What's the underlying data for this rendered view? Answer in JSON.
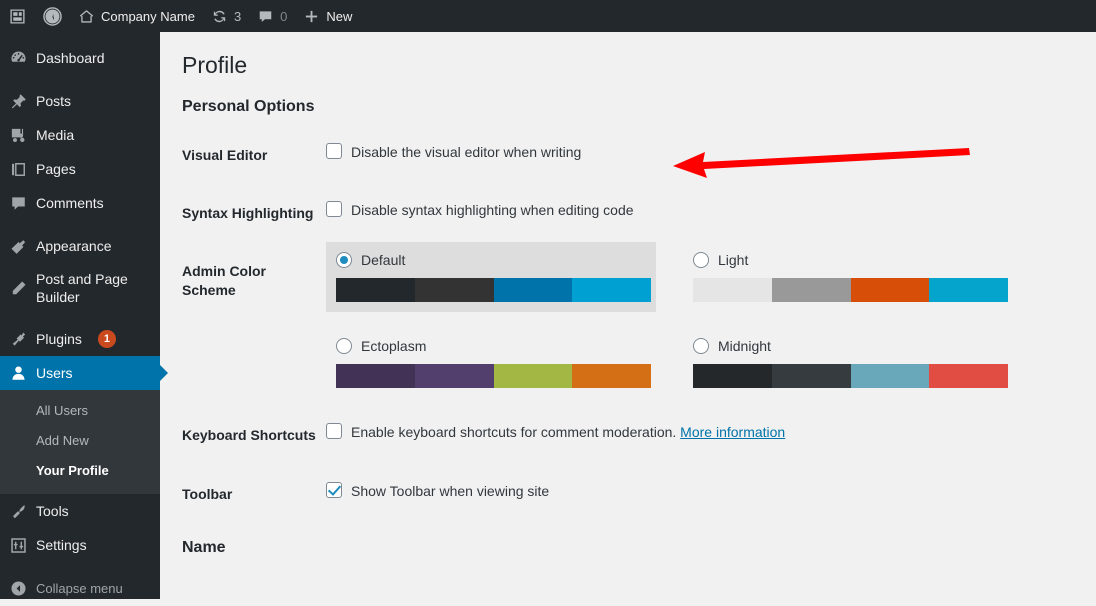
{
  "adminbar": {
    "items": [
      {
        "icon": "wp-logo-placeholder-icon",
        "label": ""
      },
      {
        "icon": "wordpress-logo-icon",
        "label": ""
      },
      {
        "icon": "home-icon",
        "label": "Company Name"
      },
      {
        "icon": "updates-icon",
        "label": "3"
      },
      {
        "icon": "comment-bubble-icon",
        "label": "0"
      },
      {
        "icon": "plus-icon",
        "label": "New"
      }
    ],
    "site_name": "Company Name",
    "updates_count": "3",
    "comments_count": "0",
    "new_label": "New"
  },
  "sidebar": {
    "items": [
      {
        "label": "Dashboard",
        "icon": "dashboard-icon",
        "badge": ""
      },
      {
        "label": "Posts",
        "icon": "pin-icon",
        "badge": ""
      },
      {
        "label": "Media",
        "icon": "media-icon",
        "badge": ""
      },
      {
        "label": "Pages",
        "icon": "pages-icon",
        "badge": ""
      },
      {
        "label": "Comments",
        "icon": "comment-bubble-icon",
        "badge": ""
      },
      {
        "label": "Appearance",
        "icon": "paintbrush-icon",
        "badge": ""
      },
      {
        "label": "Post and Page Builder",
        "icon": "pencil-icon",
        "badge": ""
      },
      {
        "label": "Plugins",
        "icon": "plug-icon",
        "badge": "1"
      },
      {
        "label": "Users",
        "icon": "user-icon",
        "badge": ""
      },
      {
        "label": "Tools",
        "icon": "wrench-icon",
        "badge": ""
      },
      {
        "label": "Settings",
        "icon": "settings-sliders-icon",
        "badge": ""
      }
    ],
    "users_submenu": [
      {
        "label": "All Users",
        "current": false
      },
      {
        "label": "Add New",
        "current": false
      },
      {
        "label": "Your Profile",
        "current": true
      }
    ],
    "collapse_label": "Collapse menu",
    "collapse_icon": "collapse-arrow-icon",
    "active_item": "Users",
    "accent_color": "#0073aa",
    "background_color": "#23282d"
  },
  "main": {
    "page_title": "Profile",
    "personal_options_title": "Personal Options",
    "name_section_title": "Name",
    "rows": {
      "visual_editor": {
        "label": "Visual Editor",
        "checkbox_label": "Disable the visual editor when writing",
        "checked": false
      },
      "syntax_highlighting": {
        "label": "Syntax Highlighting",
        "checkbox_label": "Disable syntax highlighting when editing code",
        "checked": false
      },
      "admin_color_scheme": {
        "label": "Admin Color Scheme",
        "schemes": [
          {
            "name": "Default",
            "selected": true,
            "colors": [
              "#23282d",
              "#333333",
              "#0073aa",
              "#00a0d2"
            ]
          },
          {
            "name": "Light",
            "selected": false,
            "colors": [
              "#e5e5e5",
              "#999999",
              "#d64e07",
              "#04a4cc"
            ]
          },
          {
            "name": "Ectoplasm",
            "selected": false,
            "colors": [
              "#413256",
              "#523f6d",
              "#a3b745",
              "#d46f15"
            ]
          },
          {
            "name": "Midnight",
            "selected": false,
            "colors": [
              "#25282b",
              "#363b3f",
              "#69a8bb",
              "#e14d43"
            ]
          }
        ]
      },
      "keyboard_shortcuts": {
        "label": "Keyboard Shortcuts",
        "checkbox_label": "Enable keyboard shortcuts for comment moderation.",
        "link_label": "More information",
        "checked": false
      },
      "toolbar": {
        "label": "Toolbar",
        "checkbox_label": "Show Toolbar when viewing site",
        "checked": true
      }
    }
  },
  "annotation": {
    "type": "arrow",
    "color": "#ff0000",
    "points_to": "Disable the visual editor when writing"
  }
}
